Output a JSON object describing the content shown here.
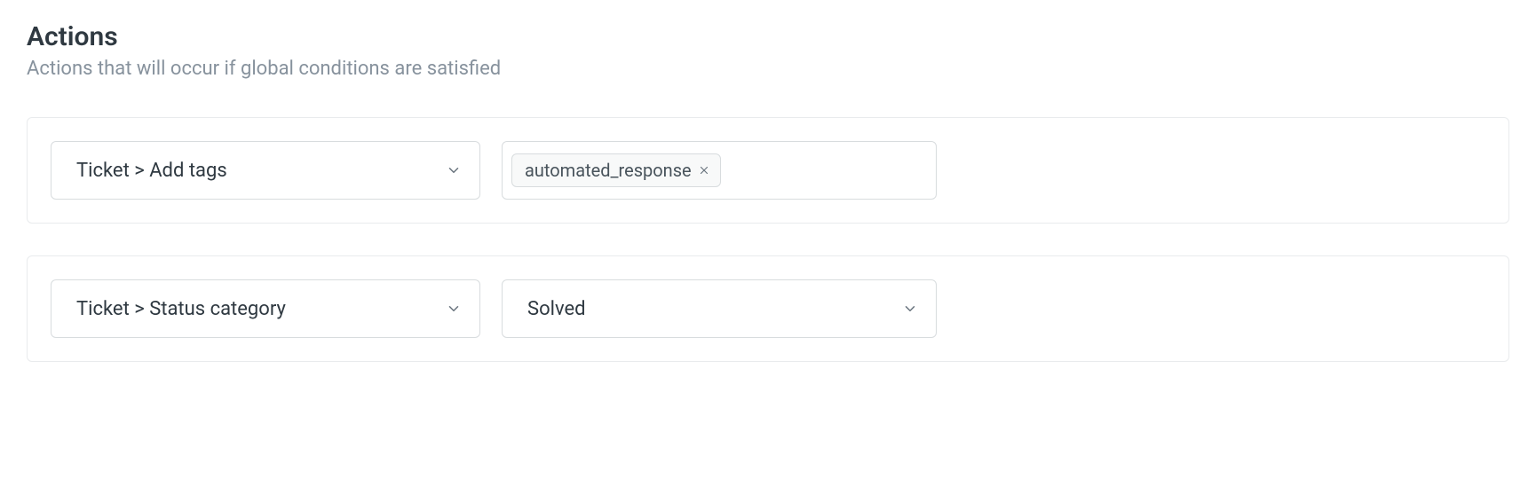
{
  "section": {
    "title": "Actions",
    "description": "Actions that will occur if global conditions are satisfied"
  },
  "rows": [
    {
      "typeDropdown": {
        "value": "Ticket > Add tags"
      },
      "tags": [
        {
          "label": "automated_response"
        }
      ]
    },
    {
      "typeDropdown": {
        "value": "Ticket > Status category"
      },
      "valueDropdown": {
        "value": "Solved"
      }
    }
  ]
}
